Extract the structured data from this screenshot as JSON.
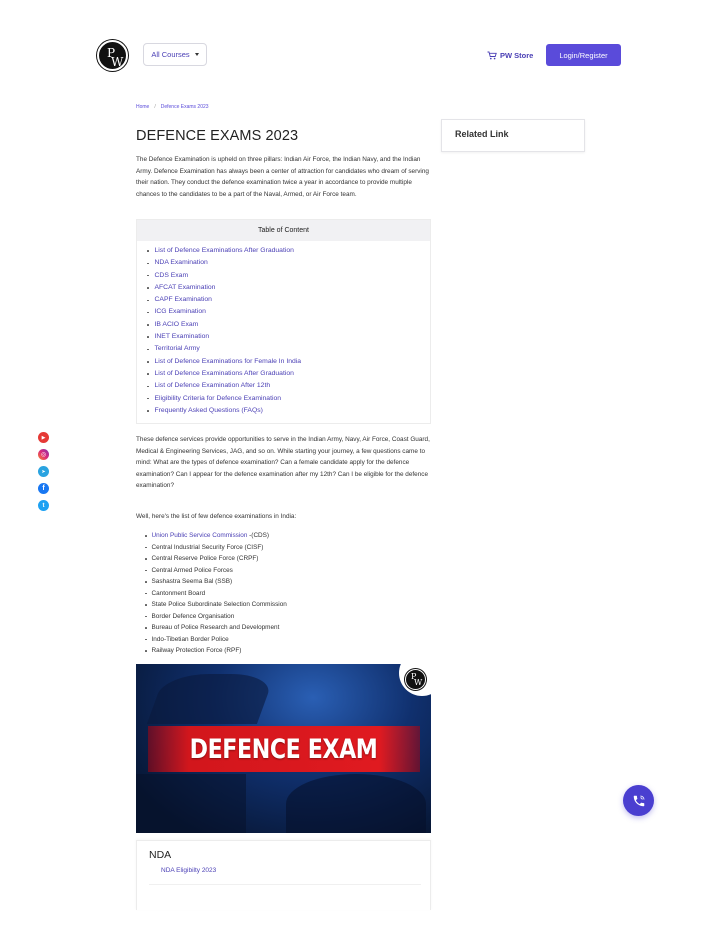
{
  "header": {
    "logo_text": {
      "p": "P",
      "w": "W"
    },
    "courses_button": "All Courses",
    "store_link": "PW Store",
    "login_button": "Login/Register"
  },
  "breadcrumb": {
    "home": "Home",
    "separator": "/",
    "current": "Defence Exams 2023"
  },
  "page_title": "DEFENCE EXAMS 2023",
  "intro_paragraph": "The Defence Examination is upheld on three pillars: Indian Air Force, the Indian Navy, and the Indian Army. Defence Examination has always been a center of attraction for candidates who dream of serving their nation. They conduct the defence examination twice a year in accordance to provide multiple chances to the candidates to be a part of the Naval, Armed, or Air Force team.",
  "toc": {
    "heading": "Table of Content",
    "items": [
      "List of Defence Examinations After Graduation",
      "NDA Examination",
      "CDS Exam",
      "AFCAT Examination",
      "CAPF Examination",
      "ICG Examination",
      "IB ACIO Exam",
      "INET Examination",
      "Territorial Army",
      "List of Defence Examinations for Female In India",
      "List of Defence Examinations After Graduation",
      "List of Defence Examination After 12th",
      "Eligibility Criteria for Defence Examination",
      "Frequently Asked Questions (FAQs)"
    ]
  },
  "services_paragraph": "These defence services provide opportunities to serve in the Indian Army, Navy, Air Force, Coast Guard, Medical & Engineering Services, JAG, and so on. While starting your journey, a few questions came to mind: What are the types of defence examination? Can a female candidate apply for the defence examination? Can I appear for the defence examination after my 12th? Can I be eligible for the defence examination?",
  "list_intro": "Well, here's the list of few defence examinations in India:",
  "organisations": {
    "first_link": "Union Public Service Commission",
    "first_suffix": " -(CDS)",
    "items": [
      "Central Industrial Security Force (CISF)",
      "Central Reserve Police Force (CRPF)",
      "Central Armed Police Forces",
      "Sashastra Seema Bal (SSB)",
      "Cantonment Board",
      "State Police Subordinate Selection Commission",
      "Border Defence Organisation",
      "Bureau of Police Research and Development",
      "Indo-Tibetian Border Police",
      "Railway Protection Force (RPF)"
    ]
  },
  "banner": {
    "text": "DEFENCE EXAM",
    "logo": {
      "p": "P",
      "w": "W"
    }
  },
  "nda_card": {
    "title": "NDA",
    "link": "NDA Eligibilty 2023"
  },
  "related": {
    "title": "Related Link"
  },
  "social": [
    {
      "name": "youtube",
      "color": "#e53935",
      "glyph": "▶"
    },
    {
      "name": "instagram",
      "color": "#c13584",
      "glyph": "◎"
    },
    {
      "name": "telegram",
      "color": "#2aa3e0",
      "glyph": "➤"
    },
    {
      "name": "facebook",
      "color": "#1877f2",
      "glyph": "f"
    },
    {
      "name": "twitter",
      "color": "#1da1f2",
      "glyph": "t"
    }
  ],
  "colors": {
    "brand": "#5a4bda",
    "link": "#4a3fb5",
    "banner_red": "#e01a20"
  }
}
